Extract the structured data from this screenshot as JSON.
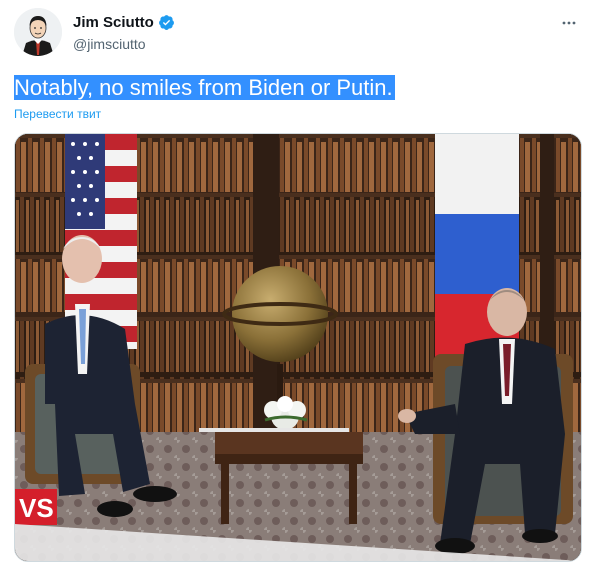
{
  "author": {
    "display_name": "Jim Sciutto",
    "handle": "@jimsciutto"
  },
  "tweet": {
    "text": "Notably, no smiles from Biden or Putin.",
    "translate_label": "Перевести твит"
  },
  "media": {
    "overlay_text": "VS"
  },
  "colors": {
    "accent": "#1d9bf0",
    "selection": "#3390ff"
  }
}
